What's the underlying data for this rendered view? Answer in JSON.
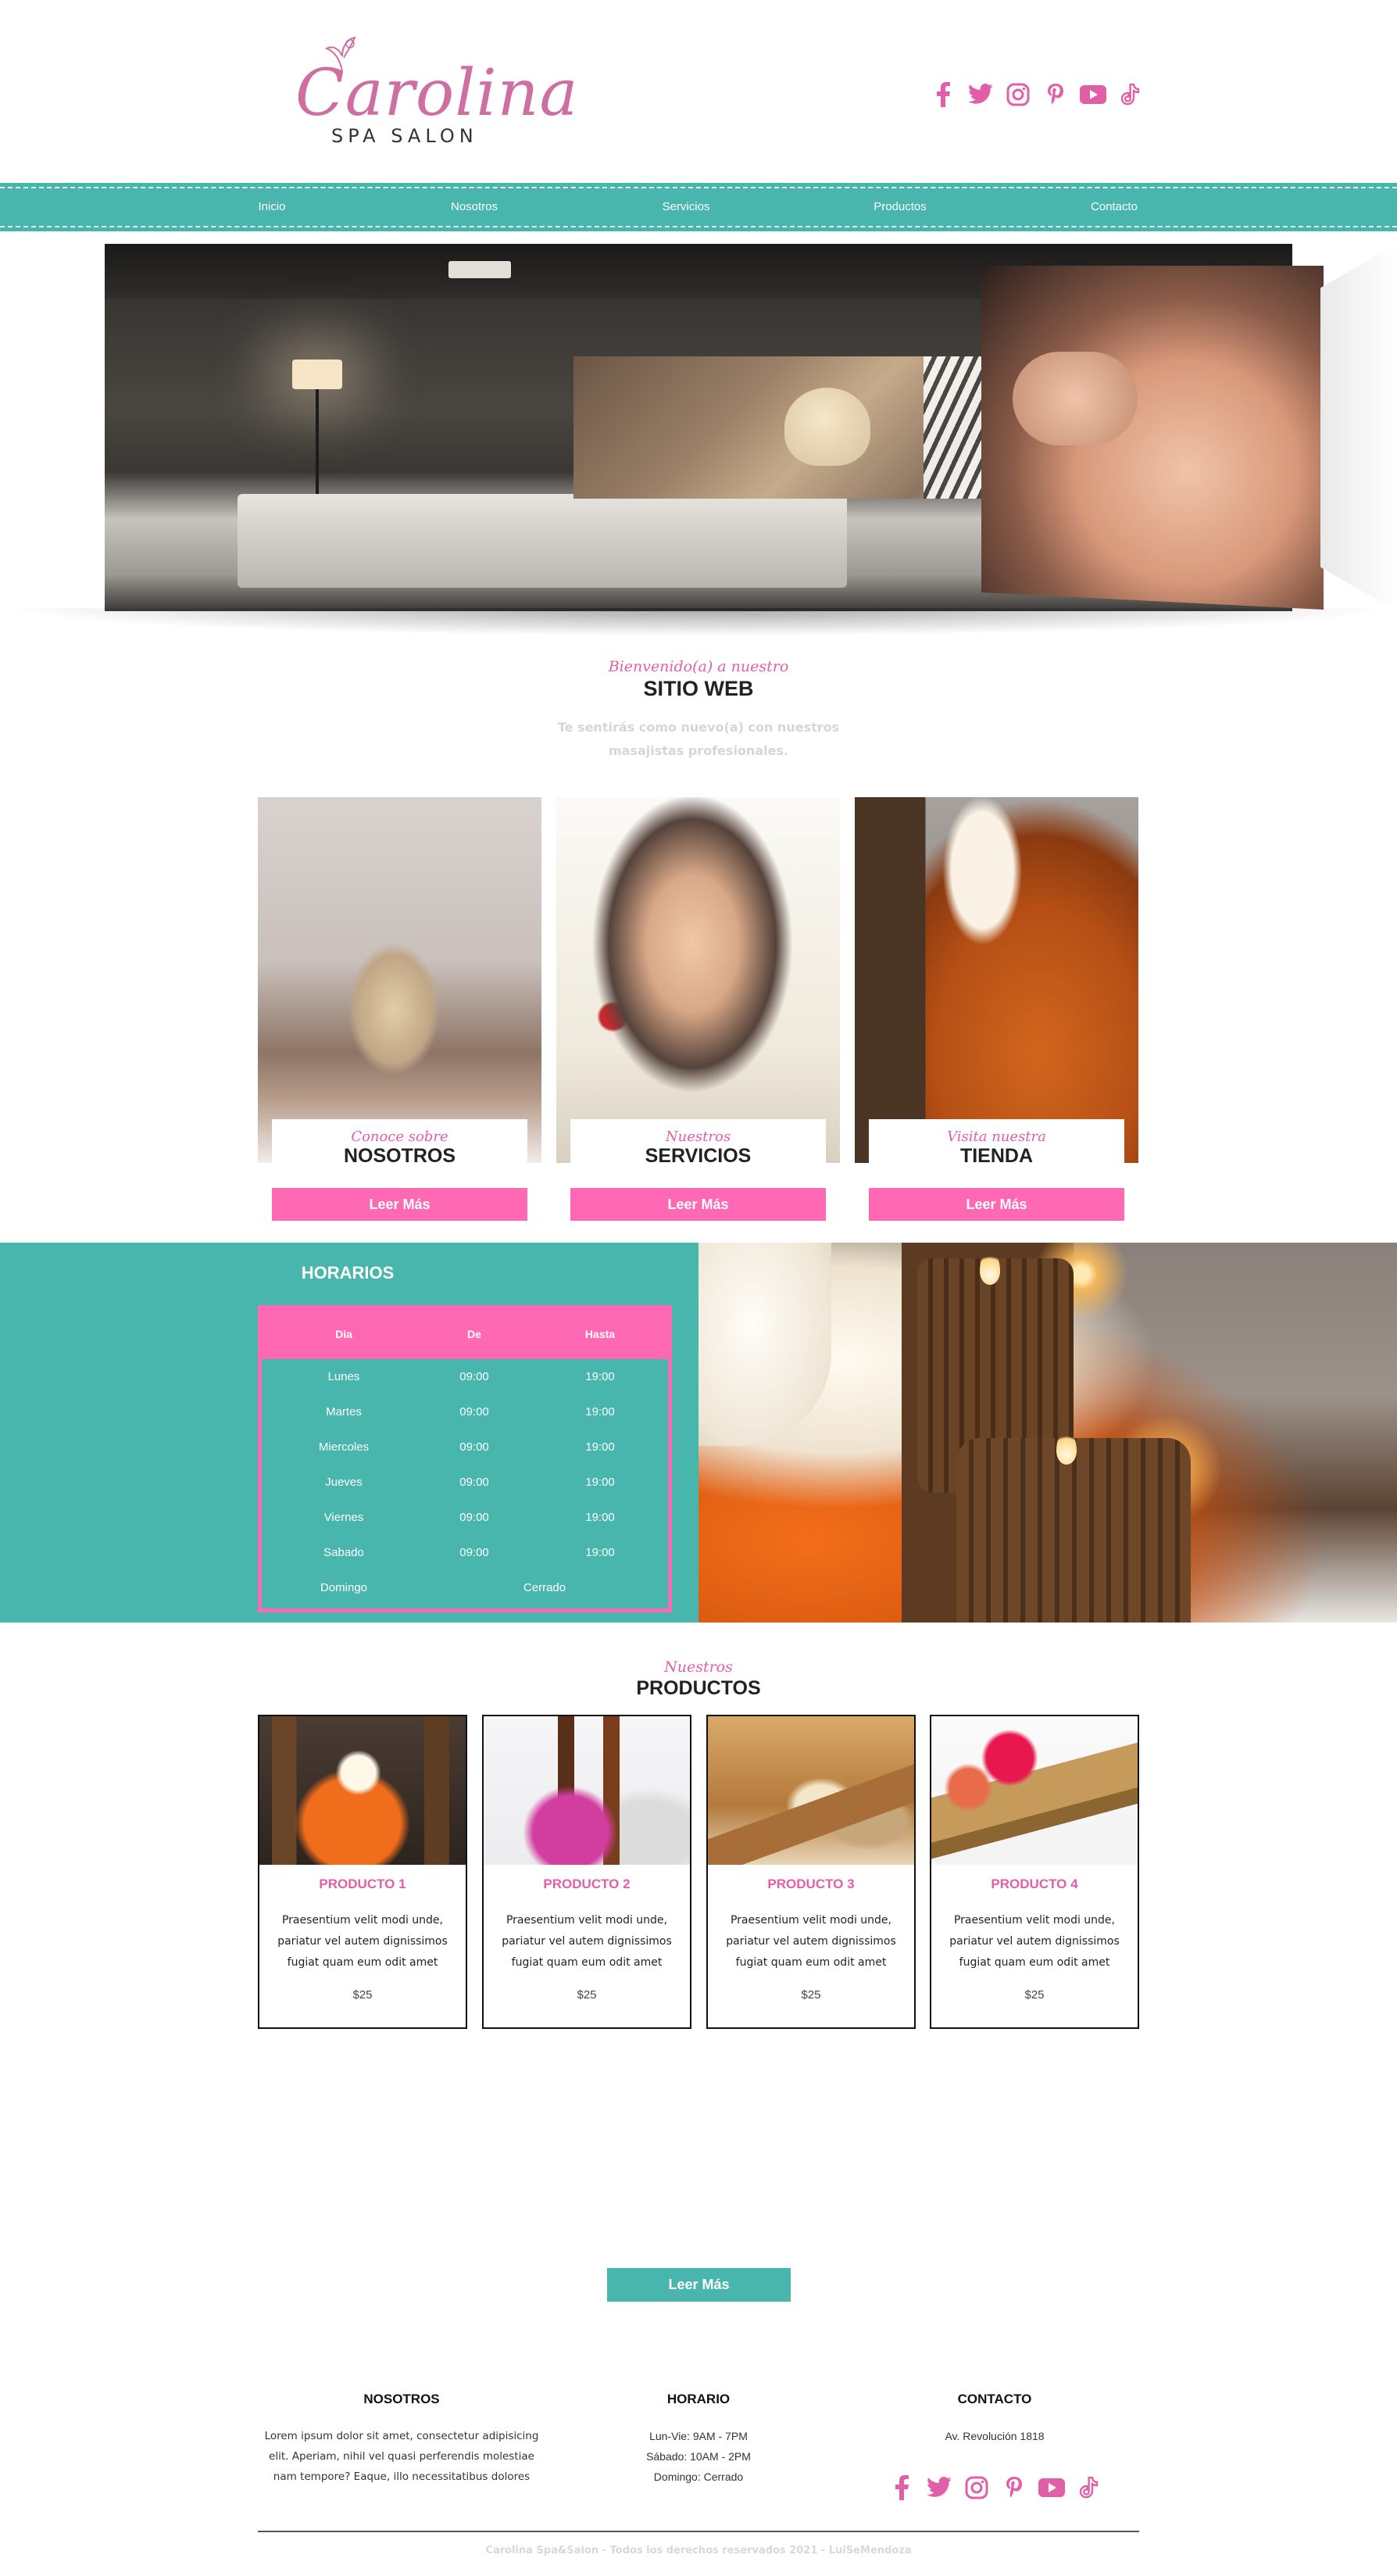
{
  "brand": {
    "logo_script": "Carolina",
    "logo_sub": "SPA SALON",
    "accent_pink": "#e05fa7",
    "button_pink": "#ff69b4",
    "teal": "#49b6ad"
  },
  "social_icons": [
    "facebook-icon",
    "twitter-icon",
    "instagram-icon",
    "pinterest-icon",
    "youtube-icon",
    "tiktok-icon"
  ],
  "nav": {
    "items": [
      "Inicio",
      "Nosotros",
      "Servicios",
      "Productos",
      "Contacto"
    ]
  },
  "welcome": {
    "script": "Bienvenido(a) a nuestro",
    "title": "SITIO WEB",
    "text": "Te sentirás como nuevo(a) con nuestros masajistas profesionales."
  },
  "cards": [
    {
      "script": "Conoce sobre",
      "title": "NOSOTROS",
      "button": "Leer Más"
    },
    {
      "script": "Nuestros",
      "title": "SERVICIOS",
      "button": "Leer Más"
    },
    {
      "script": "Visita nuestra",
      "title": "TIENDA",
      "button": "Leer Más"
    }
  ],
  "hours": {
    "title": "HORARIOS",
    "headers": [
      "Dia",
      "De",
      "Hasta"
    ],
    "rows": [
      {
        "day": "Lunes",
        "from": "09:00",
        "to": "19:00"
      },
      {
        "day": "Martes",
        "from": "09:00",
        "to": "19:00"
      },
      {
        "day": "Miercoles",
        "from": "09:00",
        "to": "19:00"
      },
      {
        "day": "Jueves",
        "from": "09:00",
        "to": "19:00"
      },
      {
        "day": "Viernes",
        "from": "09:00",
        "to": "19:00"
      },
      {
        "day": "Sabado",
        "from": "09:00",
        "to": "19:00"
      }
    ],
    "closed_day": "Domingo",
    "closed_label": "Cerrado"
  },
  "products": {
    "script": "Nuestros",
    "title": "PRODUCTOS",
    "items": [
      {
        "name": "PRODUCTO 1",
        "desc": "Praesentium velit modi unde, pariatur vel autem dignissimos fugiat quam eum odit amet",
        "price": "$25"
      },
      {
        "name": "PRODUCTO 2",
        "desc": "Praesentium velit modi unde, pariatur vel autem dignissimos fugiat quam eum odit amet",
        "price": "$25"
      },
      {
        "name": "PRODUCTO 3",
        "desc": "Praesentium velit modi unde, pariatur vel autem dignissimos fugiat quam eum odit amet",
        "price": "$25"
      },
      {
        "name": "PRODUCTO 4",
        "desc": "Praesentium velit modi unde, pariatur vel autem dignissimos fugiat quam eum odit amet",
        "price": "$25"
      }
    ],
    "more_button": "Leer Más"
  },
  "footer": {
    "about_title": "NOSOTROS",
    "about_text": "Lorem ipsum dolor sit amet, consectetur adipisicing elit. Aperiam, nihil vel quasi perferendis molestiae nam tempore? Eaque, illo necessitatibus dolores",
    "hours_title": "HORARIO",
    "hours_lines": [
      "Lun-Vie: 9AM - 7PM",
      "Sábado: 10AM - 2PM",
      "Domingo: Cerrado"
    ],
    "contact_title": "CONTACTO",
    "address": "Av. Revolución 1818",
    "copyright": "Carolina Spa&Salon - Todos los derechos reservados 2021 - LuiSeMendoza"
  }
}
